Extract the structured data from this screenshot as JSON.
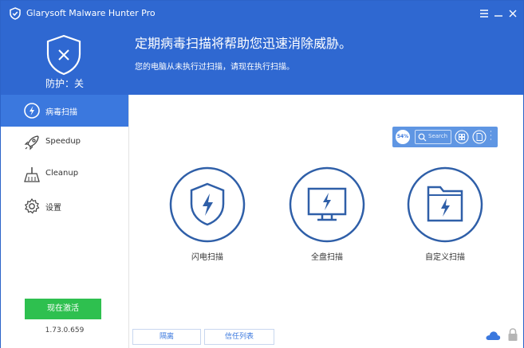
{
  "window": {
    "title": "Glarysoft Malware Hunter Pro",
    "icons": {
      "logo": "shield-logo-icon",
      "menu": "menu-icon",
      "minimize": "minimize-icon",
      "close": "close-icon"
    }
  },
  "header": {
    "status_label": "防护：关",
    "headline": "定期病毒扫描将帮助您迅速消除威胁。",
    "subline": "您的电脑从未执行过扫描，请现在执行扫描。",
    "status_icon": "shield-x-icon"
  },
  "sidebar": {
    "items": [
      {
        "label": "病毒扫描",
        "icon": "scan-bolt-icon",
        "active": true
      },
      {
        "label": "Speedup",
        "icon": "rocket-icon",
        "active": false
      },
      {
        "label": "Cleanup",
        "icon": "broom-icon",
        "active": false
      },
      {
        "label": "设置",
        "icon": "gear-icon",
        "active": false
      }
    ],
    "activate_label": "现在激活",
    "version": "1.73.0.659"
  },
  "toolbar": {
    "badge": "54%",
    "search_label": "Search",
    "icons": [
      "grid-icon",
      "document-icon",
      "more-icon"
    ]
  },
  "scan_options": [
    {
      "label": "闪电扫描",
      "icon": "shield-bolt-icon"
    },
    {
      "label": "全盘扫描",
      "icon": "monitor-bolt-icon"
    },
    {
      "label": "自定义扫描",
      "icon": "folder-bolt-icon"
    }
  ],
  "bottom": {
    "quarantine_label": "隔离",
    "trust_list_label": "信任列表",
    "icons": [
      "cloud-icon",
      "lock-icon"
    ]
  },
  "colors": {
    "header_blue": "#2f68d1",
    "sidebar_active": "#3b78de",
    "activate_green": "#2ec04f",
    "circle_blue": "#2f5fa8"
  }
}
